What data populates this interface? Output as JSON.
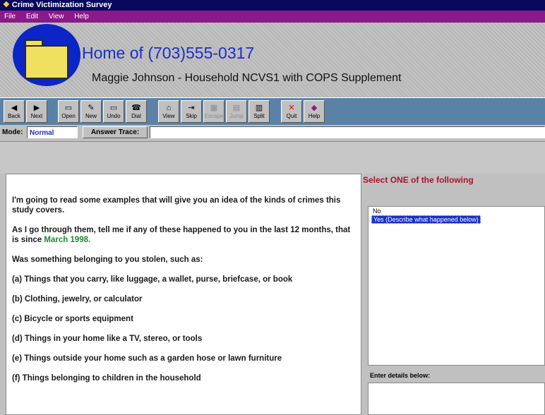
{
  "window": {
    "title": "Crime Victimization Survey",
    "icon": "app-icon"
  },
  "menu": [
    "File",
    "Edit",
    "View",
    "Help"
  ],
  "header": {
    "title": "Home of (703)555-0317",
    "subtitle": "Maggie Johnson -  Household NCVS1 with COPS Supplement"
  },
  "toolbar": {
    "buttons": [
      {
        "label": "Back",
        "icon": "back-arrow-icon",
        "glyph": "◀"
      },
      {
        "label": "Next",
        "icon": "next-arrow-icon",
        "glyph": "▶"
      },
      {
        "label": "Open",
        "icon": "folder-open-icon",
        "glyph": "▭"
      },
      {
        "label": "New",
        "icon": "new-icon",
        "glyph": "✎"
      },
      {
        "label": "Undo",
        "icon": "undo-icon",
        "glyph": "▭"
      },
      {
        "label": "Dial",
        "icon": "phone-dial-icon",
        "glyph": "☎"
      },
      {
        "label": "View",
        "icon": "home-view-icon",
        "glyph": "⌂"
      },
      {
        "label": "Skip",
        "icon": "skip-icon",
        "glyph": "⇥"
      },
      {
        "label": "Escape",
        "icon": "escape-icon",
        "glyph": "▦"
      },
      {
        "label": "Jump",
        "icon": "jump-icon",
        "glyph": "▤"
      },
      {
        "label": "Split",
        "icon": "split-icon",
        "glyph": "▥"
      },
      {
        "label": "Quit",
        "icon": "quit-x-icon",
        "glyph": "✕"
      },
      {
        "label": "Help",
        "icon": "help-icon",
        "glyph": "◆"
      }
    ]
  },
  "modebar": {
    "mode_label": "Mode:",
    "mode_value": "Normal",
    "trace_label": "Answer Trace:",
    "trace_value": ""
  },
  "question": {
    "intro": "I'm going to read some examples that will give you an idea of the kinds of crimes this study covers.",
    "period_text": "As I go through them, tell me if any of these happened to you in the last 12 months, that is since ",
    "period_date": "March 1998.",
    "prompt": "Was something belonging to you stolen, such as:",
    "items": [
      "(a) Things that you carry, like luggage, a wallet, purse, briefcase, or book",
      "(b) Clothing, jewelry, or calculator",
      "(c) Bicycle or sports equipment",
      "(d) Things in your home like a TV, stereo, or tools",
      "(e) Things outside your home such as a garden hose or lawn furniture",
      "(f) Things belonging to children in the household"
    ]
  },
  "answers": {
    "title": "Select ONE of the following",
    "options": [
      "No",
      "Yes (Describe what happened below)"
    ],
    "selected": 1,
    "details_label": "Enter details below:",
    "details_value": ""
  },
  "colors": {
    "titlebar": "#08085e",
    "menubar": "#8a1a8a",
    "toolbar": "#5a82a6",
    "accent_blue": "#1a2fc8",
    "date_green": "#1c8a2c",
    "select_red": "#b0102a"
  }
}
